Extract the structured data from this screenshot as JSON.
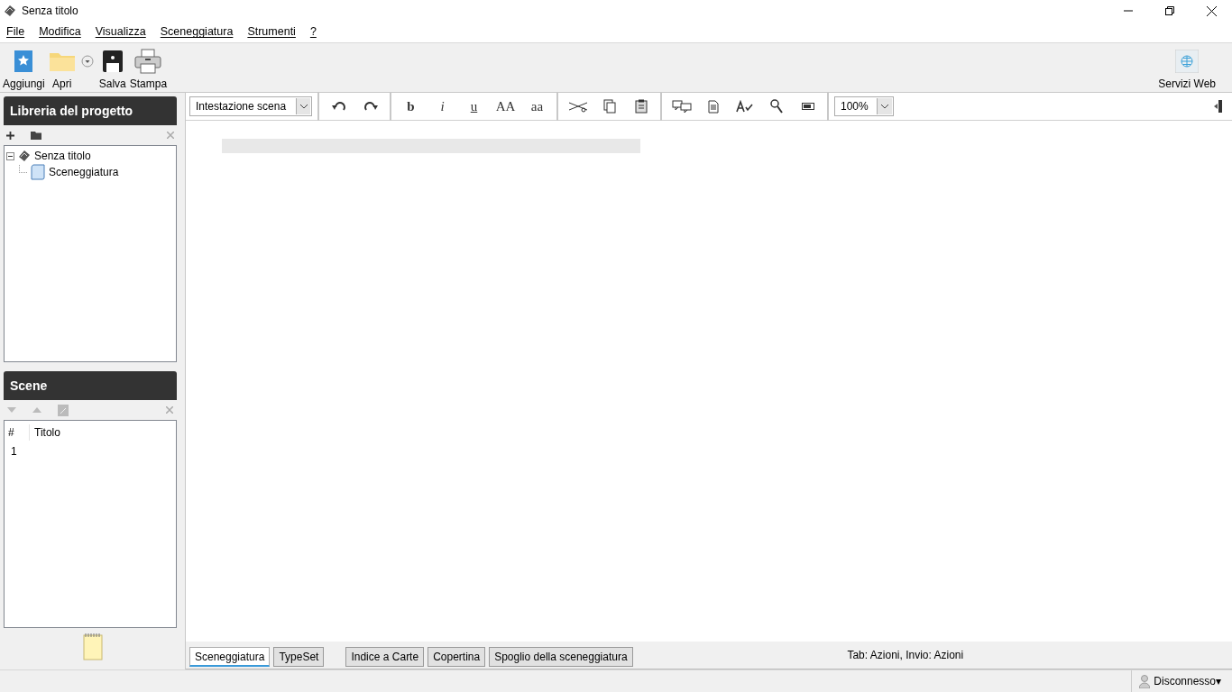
{
  "window": {
    "title": "Senza titolo"
  },
  "menu": [
    "File",
    "Modifica",
    "Visualizza",
    "Sceneggiatura",
    "Strumenti",
    "?"
  ],
  "toolbar": [
    {
      "kind": "button",
      "label": "Aggiungi"
    },
    {
      "kind": "button",
      "label": "Apri"
    },
    {
      "kind": "dropdown"
    },
    {
      "kind": "button",
      "label": "Salva"
    },
    {
      "kind": "button",
      "label": "Stampa"
    }
  ],
  "toolbar_right": {
    "label": "Servizi Web"
  },
  "library": {
    "title": "Libreria del progetto",
    "tree": [
      {
        "label": "Senza titolo",
        "expanded": true,
        "children": [
          {
            "label": "Sceneggiatura"
          }
        ]
      }
    ]
  },
  "scenes": {
    "title": "Scene",
    "columns": [
      "#",
      "Titolo"
    ],
    "rows": [
      {
        "number": "1"
      }
    ]
  },
  "format_bar": {
    "element_type": "Intestazione scena",
    "zoom": "100%",
    "groups": [
      [
        {
          "kind": "icon"
        },
        {
          "kind": "icon"
        }
      ],
      [
        {
          "kind": "bold",
          "label": "b"
        },
        {
          "kind": "italic",
          "label": "i"
        },
        {
          "kind": "underline",
          "label": "u"
        },
        {
          "kind": "text",
          "label": "AA"
        },
        {
          "kind": "text",
          "label": "aa"
        }
      ],
      [
        {
          "kind": "icon"
        },
        {
          "kind": "icon"
        },
        {
          "kind": "icon"
        }
      ],
      [
        {
          "kind": "icon"
        },
        {
          "kind": "icon"
        },
        {
          "kind": "icon"
        },
        {
          "kind": "icon"
        },
        {
          "kind": "icon"
        }
      ]
    ]
  },
  "bottom_tabs": [
    [
      {
        "label": "Sceneggiatura",
        "selected": true
      },
      {
        "label": "TypeSet",
        "selected": false
      }
    ],
    [
      {
        "label": "Indice a Carte",
        "selected": false
      },
      {
        "label": "Copertina",
        "selected": false
      },
      {
        "label": "Spoglio della sceneggiatura",
        "selected": false
      }
    ]
  ],
  "hint": "Tab: Azioni, Invio: Azioni",
  "status_bar": {
    "account": "Disconnesso▾"
  }
}
